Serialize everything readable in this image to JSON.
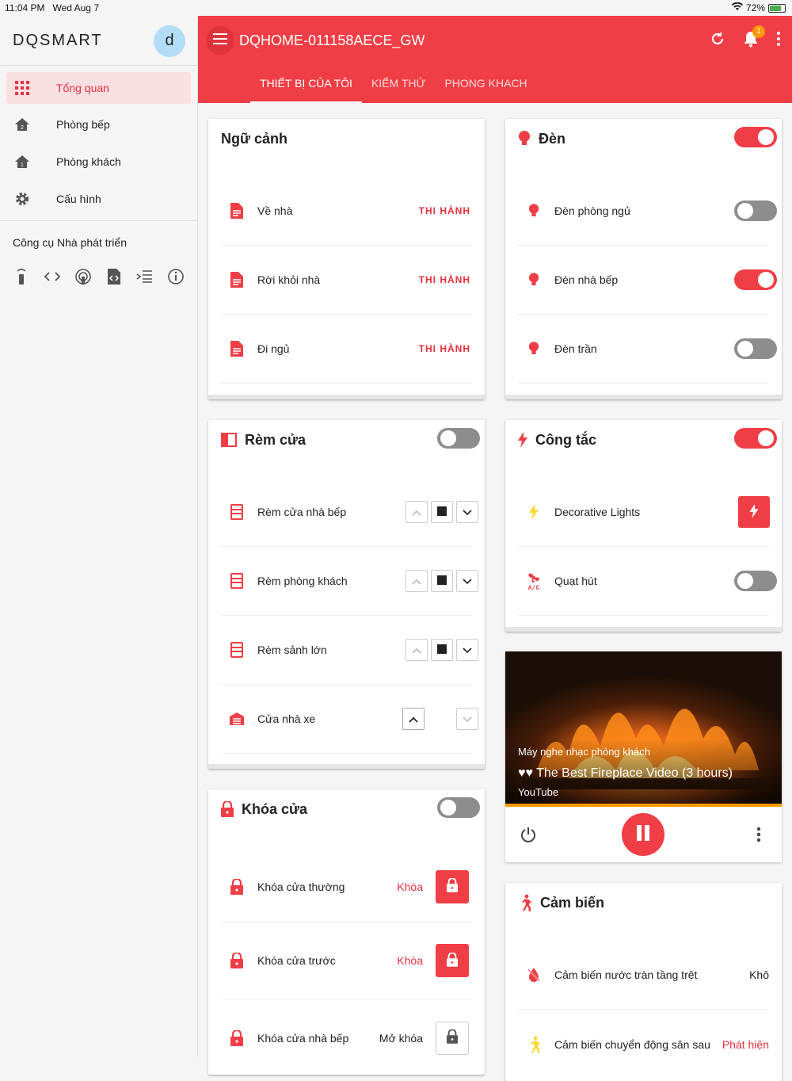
{
  "statusbar": {
    "time": "11:04 PM",
    "date": "Wed Aug 7",
    "battery": "72%"
  },
  "sidebar": {
    "brand": "DQSMART",
    "avatar": "d",
    "items": [
      {
        "label": "Tổng quan",
        "icon": "grid-icon",
        "active": true
      },
      {
        "label": "Phòng bếp",
        "icon": "home-icon"
      },
      {
        "label": "Phòng khách",
        "icon": "home-icon"
      },
      {
        "label": "Cấu hình",
        "icon": "gear-icon"
      }
    ],
    "dev_title": "Công cụ Nhà phát triển",
    "dev_tools": [
      "remote-icon",
      "code-icon",
      "broadcast-icon",
      "file-code-icon",
      "list-icon",
      "info-icon"
    ]
  },
  "topbar": {
    "title": "DQHOME-011158AECE_GW",
    "notification_count": "1",
    "tabs": [
      "THIẾT BỊ CỦA TÔI",
      "KIỂM THỬ",
      "PHONG KHACH"
    ]
  },
  "colors": {
    "accent": "#f03e46",
    "active_bg": "#fbe0e2",
    "warning": "#ff9800"
  },
  "scenes": {
    "title": "Ngữ cảnh",
    "items": [
      {
        "name": "Về nhà",
        "action": "THI HÀNH"
      },
      {
        "name": "Rời khỏi nhà",
        "action": "THI HÀNH"
      },
      {
        "name": "Đi ngủ",
        "action": "THI HÀNH"
      }
    ]
  },
  "lights": {
    "title": "Đèn",
    "master_on": true,
    "items": [
      {
        "name": "Đèn phòng ngủ",
        "on": false
      },
      {
        "name": "Đèn nhà bếp",
        "on": true
      },
      {
        "name": "Đèn trần",
        "on": false
      }
    ]
  },
  "curtains": {
    "title": "Rèm cửa",
    "master_on": false,
    "items": [
      {
        "name": "Rèm cửa nhà bếp"
      },
      {
        "name": "Rèm phòng khách"
      },
      {
        "name": "Rèm sảnh lớn"
      },
      {
        "name": "Cửa nhà xe"
      }
    ]
  },
  "switches": {
    "title": "Công tắc",
    "master_on": true,
    "items": [
      {
        "name": "Decorative Lights"
      },
      {
        "name": "Quạt hút",
        "on": false
      }
    ]
  },
  "media": {
    "player": "Máy nghe nhạc phòng khách",
    "track": "♥♥ The Best Fireplace Video (3 hours)",
    "source": "YouTube"
  },
  "locks": {
    "title": "Khóa cửa",
    "master_on": false,
    "items": [
      {
        "name": "Khóa cửa thường",
        "state": "Khóa"
      },
      {
        "name": "Khóa cửa trước",
        "state": "Khóa"
      },
      {
        "name": "Khóa cửa nhà bếp",
        "state": "Mở khóa"
      }
    ]
  },
  "sensors": {
    "title": "Cảm biến",
    "items": [
      {
        "name": "Cảm biến nước tràn tầng trệt",
        "value": "Khô"
      },
      {
        "name": "Cảm biến chuyển động sân sau",
        "value": "Phát hiện"
      }
    ]
  }
}
